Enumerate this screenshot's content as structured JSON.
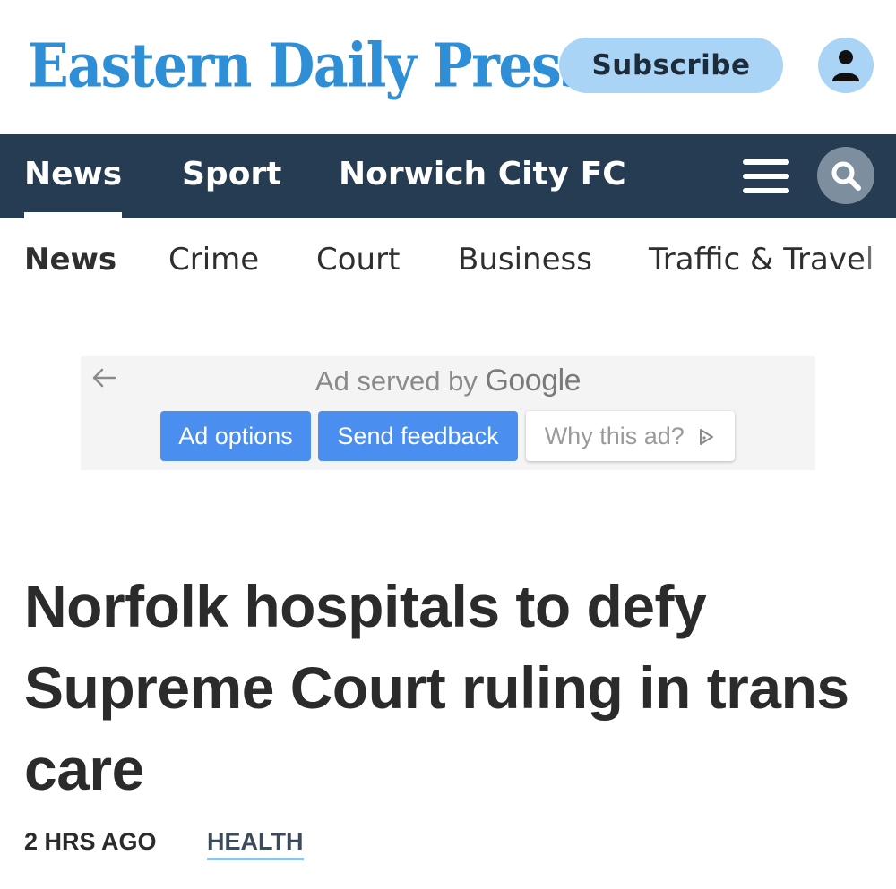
{
  "masthead": {
    "logo_text": "Eastern Daily Press",
    "subscribe_label": "Subscribe",
    "account_icon": "user-icon",
    "brand_color": "#2f8fd6"
  },
  "main_nav": {
    "tabs": [
      {
        "label": "News",
        "active": true
      },
      {
        "label": "Sport",
        "active": false
      },
      {
        "label": "Norwich City FC",
        "active": false
      }
    ],
    "menu_icon": "hamburger-icon",
    "search_icon": "search-icon",
    "background": "#263c53"
  },
  "sub_nav": {
    "items": [
      {
        "label": "News",
        "active": true
      },
      {
        "label": "Crime",
        "active": false
      },
      {
        "label": "Court",
        "active": false
      },
      {
        "label": "Business",
        "active": false
      },
      {
        "label": "Traffic & Travel",
        "active": false
      }
    ]
  },
  "ad": {
    "served_prefix": "Ad served by",
    "served_brand": "Google",
    "back_icon": "back-arrow-icon",
    "options_label": "Ad options",
    "feedback_label": "Send feedback",
    "why_label": "Why this ad?",
    "why_icon": "adchoices-icon"
  },
  "article": {
    "headline": "Norfolk hospitals to defy Supreme Court ruling in trans care",
    "time": "2 HRS AGO",
    "category": "HEALTH"
  }
}
